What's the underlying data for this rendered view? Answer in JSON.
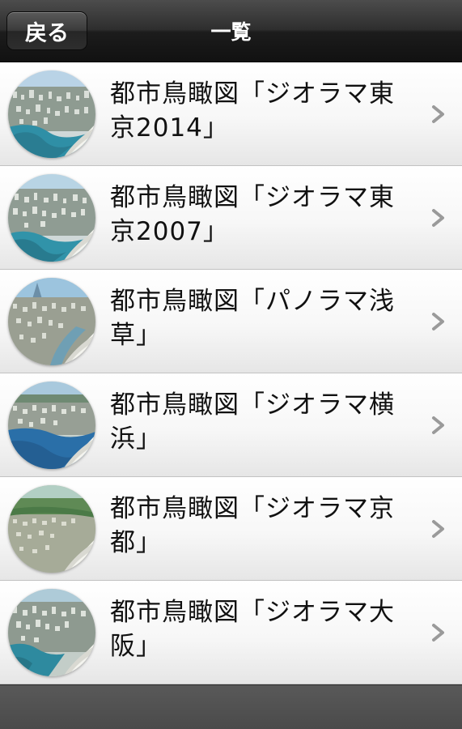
{
  "header": {
    "back_label": "戻る",
    "title": "一覧"
  },
  "list": {
    "items": [
      {
        "label": "都市鳥瞰図「ジオラマ東京2014」",
        "thumb": "sky-city"
      },
      {
        "label": "都市鳥瞰図「ジオラマ東京2007」",
        "thumb": "sky-city"
      },
      {
        "label": "都市鳥瞰図「パノラマ浅草」",
        "thumb": "river-city"
      },
      {
        "label": "都市鳥瞰図「ジオラマ横浜」",
        "thumb": "bay-city"
      },
      {
        "label": "都市鳥瞰図「ジオラマ京都」",
        "thumb": "green-city"
      },
      {
        "label": "都市鳥瞰図「ジオラマ大阪」",
        "thumb": "sky-city"
      }
    ]
  },
  "colors": {
    "navbar": "#1c1c1c",
    "row_top": "#ffffff",
    "row_bottom": "#e6e6e6",
    "text": "#111111",
    "chevron": "#9a9a9a"
  }
}
